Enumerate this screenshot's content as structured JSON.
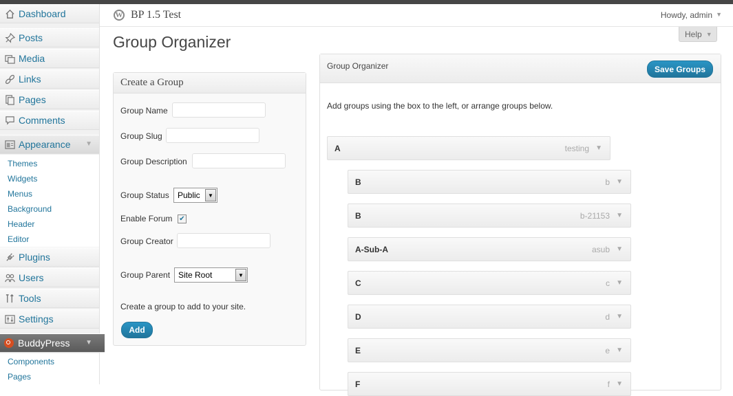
{
  "sidebar": {
    "items": [
      {
        "label": "Dashboard",
        "icon": "dashboard-icon"
      },
      {
        "label": "Posts",
        "icon": "pin-icon"
      },
      {
        "label": "Media",
        "icon": "media-icon"
      },
      {
        "label": "Links",
        "icon": "link-icon"
      },
      {
        "label": "Pages",
        "icon": "pages-icon"
      },
      {
        "label": "Comments",
        "icon": "comment-icon"
      },
      {
        "label": "Appearance",
        "icon": "appearance-icon"
      },
      {
        "label": "Plugins",
        "icon": "plugin-icon"
      },
      {
        "label": "Users",
        "icon": "users-icon"
      },
      {
        "label": "Tools",
        "icon": "tools-icon"
      },
      {
        "label": "Settings",
        "icon": "settings-icon"
      },
      {
        "label": "BuddyPress",
        "icon": "buddypress-icon"
      }
    ],
    "appearance_sub": [
      "Themes",
      "Widgets",
      "Menus",
      "Background",
      "Header",
      "Editor"
    ],
    "buddypress_sub": [
      "Components",
      "Pages"
    ]
  },
  "header": {
    "site_title": "BP 1.5 Test",
    "howdy": "Howdy, admin",
    "help": "Help"
  },
  "page_title": "Group Organizer",
  "create": {
    "heading": "Create a Group",
    "name_label": "Group Name",
    "slug_label": "Group Slug",
    "desc_label": "Group Description",
    "status_label": "Group Status",
    "status_value": "Public",
    "forum_label": "Enable Forum",
    "forum_checked": true,
    "creator_label": "Group Creator",
    "parent_label": "Group Parent",
    "parent_value": "Site Root",
    "hint": "Create a group to add to your site.",
    "add_label": "Add"
  },
  "organizer": {
    "heading": "Group Organizer",
    "save_label": "Save Groups",
    "description": "Add groups using the box to the left, or arrange groups below.",
    "groups": [
      {
        "name": "A",
        "slug": "testing",
        "level": 0
      },
      {
        "name": "B",
        "slug": "b",
        "level": 1
      },
      {
        "name": "B",
        "slug": "b-21153",
        "level": 1
      },
      {
        "name": "A-Sub-A",
        "slug": "asub",
        "level": 1
      },
      {
        "name": "C",
        "slug": "c",
        "level": 1
      },
      {
        "name": "D",
        "slug": "d",
        "level": 1
      },
      {
        "name": "E",
        "slug": "e",
        "level": 1
      },
      {
        "name": "F",
        "slug": "f",
        "level": 1
      }
    ]
  },
  "colors": {
    "link": "#21759b",
    "button": "#21759b",
    "buddypress_badge": "#d54e21"
  }
}
